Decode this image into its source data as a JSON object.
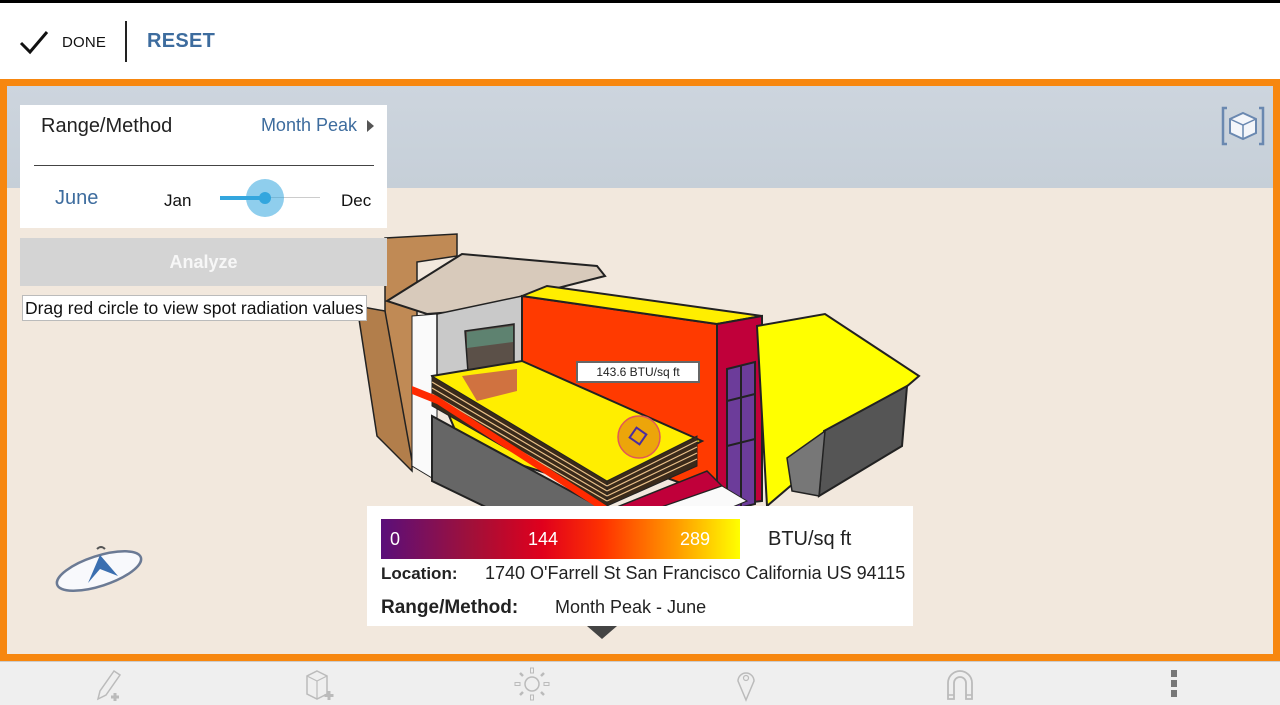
{
  "actionbar": {
    "done_label": "DONE",
    "reset_label": "RESET",
    "icons": {
      "done": "checkmark-icon"
    }
  },
  "panel": {
    "range_method_label": "Range/Method",
    "range_method_value": "Month Peak",
    "selected_month": "June",
    "slider": {
      "min_label": "Jan",
      "max_label": "Dec",
      "value_month_index": 6,
      "min_month_index": 1,
      "max_month_index": 12
    },
    "analyze_label": "Analyze",
    "hint": "Drag red circle to view spot radiation values"
  },
  "scene": {
    "spot_value_label": "143.6 BTU/sq ft",
    "icons": {
      "view_cube": "view-cube-icon",
      "compass": "compass-icon"
    }
  },
  "legend": {
    "scale_labels": [
      "0",
      "144",
      "289"
    ],
    "unit": "BTU/sq ft",
    "location_key": "Location:",
    "location_value": "1740 O'Farrell St San Francisco California US 94115",
    "range_method_key": "Range/Method:",
    "range_method_value": "Month Peak - June",
    "gradient_colors": [
      "#5a0f7a",
      "#a0103a",
      "#e0001c",
      "#ff3300",
      "#ff9900",
      "#ffff00"
    ]
  },
  "toolbar": {
    "items": [
      {
        "name": "draw-tool",
        "icon": "pencil-plus-icon"
      },
      {
        "name": "add-box-tool",
        "icon": "cube-plus-icon"
      },
      {
        "name": "solar-tool",
        "icon": "sun-icon"
      },
      {
        "name": "location-tool",
        "icon": "map-pin-icon"
      },
      {
        "name": "snap-tool",
        "icon": "magnet-icon"
      },
      {
        "name": "more-menu",
        "icon": "more-vertical-icon"
      }
    ]
  },
  "colors": {
    "accent_orange": "#f7870f",
    "link_blue": "#3d6c9e",
    "slider_blue": "#33a6de"
  }
}
